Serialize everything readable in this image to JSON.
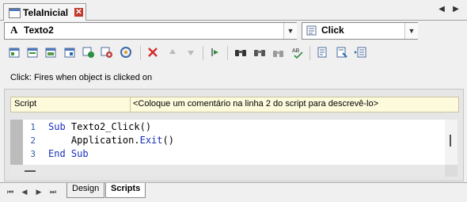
{
  "window": {
    "tab_title": "TelaInicial",
    "tab_icon": "document-icon",
    "nav_prev": "◀",
    "nav_next": "▶",
    "close": "✕"
  },
  "object_selector": {
    "icon_glyph": "A",
    "value": "Texto2"
  },
  "event_selector": {
    "value": "Click"
  },
  "toolbar": {
    "icons": [
      "insert-icon",
      "insert-property-icon",
      "insert-method-icon",
      "insert-object-icon",
      "app-browser-icon",
      "settings-icon",
      "event-icon",
      "delete-icon",
      "move-up-icon",
      "move-down-icon",
      "goto-icon",
      "find-icon",
      "find-replace-icon",
      "find-next-icon",
      "spell-check-icon",
      "comment-icon",
      "uncomment-icon",
      "indent-icon"
    ],
    "delete_color": "#d42b2b"
  },
  "description": "Click: Fires when object is clicked on",
  "script_comment": {
    "key": "Script",
    "value": "<Coloque um comentário na linha 2 do script para descrevê-lo>"
  },
  "editor": {
    "line_numbers": [
      "1",
      "2",
      "3"
    ],
    "lines": [
      {
        "kw1": "Sub",
        "text": " Texto2_Click()"
      },
      {
        "indent": "    ",
        "pre": "Application.",
        "kw": "Exit",
        "post": "()"
      },
      {
        "kw1": "End",
        "sp": " ",
        "kw2": "Sub"
      }
    ],
    "keyword_color": "#1a2fbf"
  },
  "bottom_tabs": {
    "nav": [
      "⏮",
      "◀",
      "▶",
      "⏭"
    ],
    "tabs": [
      "Design",
      "Scripts"
    ],
    "active": "Scripts"
  }
}
